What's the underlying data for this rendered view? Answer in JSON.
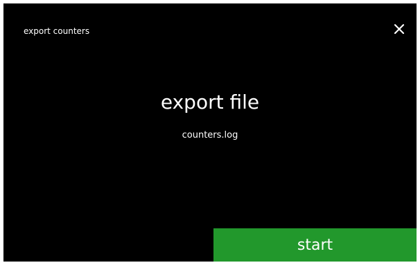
{
  "header": {
    "title": "export counters",
    "close_icon": "close-icon"
  },
  "main": {
    "heading": "export file",
    "filename": "counters.log"
  },
  "footer": {
    "start_label": "start"
  },
  "colors": {
    "screen_background": "#000000",
    "frame_background": "#ffffff",
    "text": "#ffffff",
    "start_button": "#22982c"
  }
}
